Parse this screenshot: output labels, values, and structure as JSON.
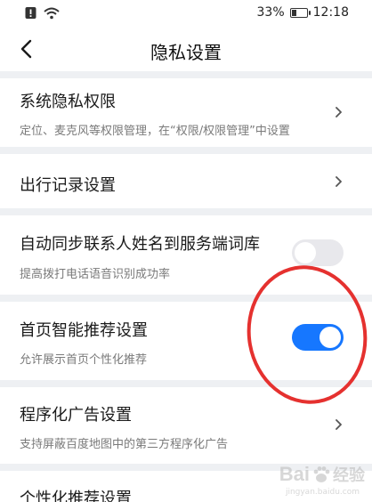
{
  "status_bar": {
    "battery_text": "33%",
    "time": "12:18",
    "battery_level": 0.33
  },
  "header": {
    "title": "隐私设置"
  },
  "items": [
    {
      "title": "系统隐私权限",
      "subtitle": "定位、麦克风等权限管理，在“权限/权限管理”中设置",
      "control": "chevron"
    },
    {
      "title": "出行记录设置",
      "control": "chevron"
    },
    {
      "title": "自动同步联系人姓名到服务端词库",
      "subtitle": "提高拨打电话语音识别成功率",
      "control": "toggle",
      "toggle_on": false
    },
    {
      "title": "首页智能推荐设置",
      "subtitle": "允许展示首页个性化推荐",
      "control": "toggle",
      "toggle_on": true
    },
    {
      "title": "程序化广告设置",
      "subtitle": "支持屏蔽百度地图中的第三方程序化广告",
      "control": "chevron"
    },
    {
      "title": "个性化推荐设置"
    }
  ],
  "colors": {
    "toggle_on": "#1677ff",
    "toggle_off": "#e8e8ec",
    "annotation_circle": "#e5312f"
  },
  "watermark": {
    "text": "Bai",
    "suffix": "经验",
    "sub": "jingyan.baidu.com"
  }
}
